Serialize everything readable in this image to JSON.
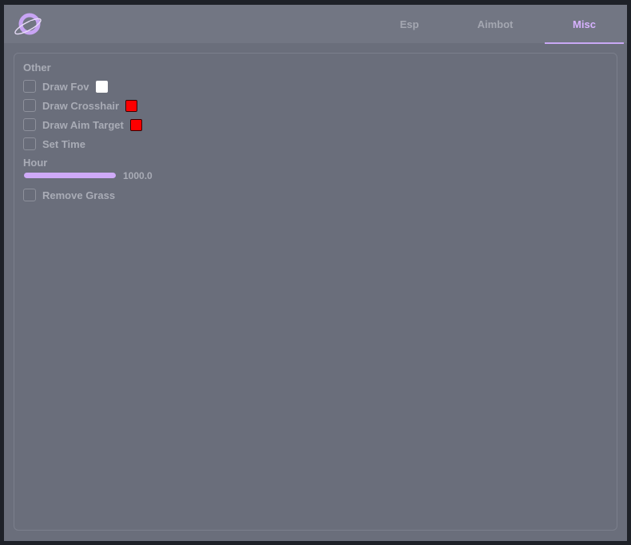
{
  "tabs": [
    {
      "label": "Esp",
      "active": false
    },
    {
      "label": "Aimbot",
      "active": false
    },
    {
      "label": "Misc",
      "active": true
    }
  ],
  "colors": {
    "accent": "#d7b2ff",
    "white_swatch": "#ffffff",
    "red_swatch": "#ff0000"
  },
  "section": {
    "title": "Other",
    "options": [
      {
        "label": "Draw Fov",
        "checked": false,
        "color": "#ffffff"
      },
      {
        "label": "Draw Crosshair",
        "checked": false,
        "color": "#ff0000"
      },
      {
        "label": "Draw Aim Target",
        "checked": false,
        "color": "#ff0000"
      },
      {
        "label": "Set Time",
        "checked": false
      }
    ],
    "slider": {
      "label": "Hour",
      "value": "1000.0",
      "fill_fraction": 1.0
    },
    "extra_option": {
      "label": "Remove Grass",
      "checked": false
    }
  }
}
